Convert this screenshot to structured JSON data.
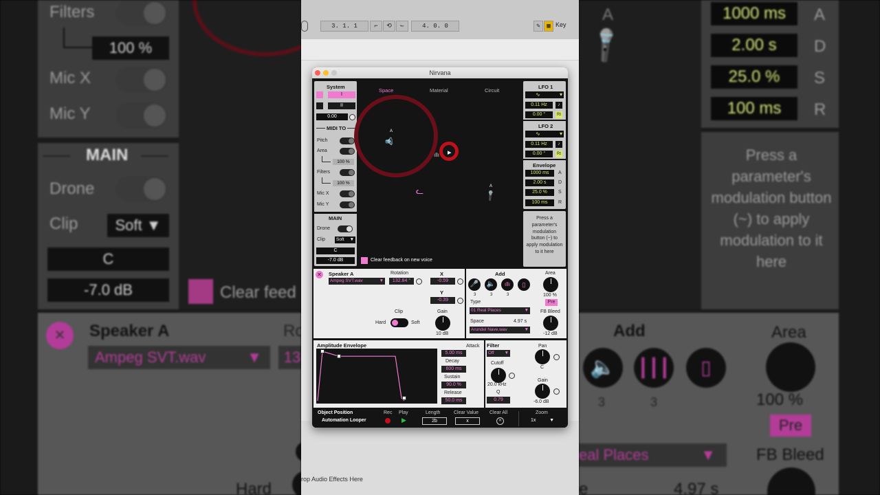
{
  "background_left": {
    "filters_label": "Filters",
    "filters_value": "100 %",
    "micx_label": "Mic X",
    "micy_label": "Mic Y",
    "main_header": "MAIN",
    "drone_label": "Drone",
    "clip_label": "Clip",
    "clip_value": "Soft",
    "note_value": "C",
    "level_value": "-7.0 dB",
    "clear_feedback_partial": "Clear feed",
    "speaker_label": "Speaker A",
    "speaker_file": "Ampeg SVT.wav",
    "rotation_partial": "Ro",
    "rotation_value_partial": "13",
    "hard_label": "Hard"
  },
  "background_right": {
    "attack": "1000 ms",
    "decay": "2.00 s",
    "sustain": "25.0 %",
    "release": "100 ms",
    "a": "A",
    "d": "D",
    "s": "S",
    "r": "R",
    "help_text": "Press a parameter's modulation button (~) to apply modulation to it here",
    "add_label": "Add",
    "area_label": "Area",
    "area_value": "100 %",
    "pre_label": "Pre",
    "count1": "3",
    "count2": "3",
    "type_partial": "eal Places",
    "fb_bleed_label": "FB Bleed",
    "space_time_partial": "4.97 s",
    "space_partial": "e",
    "a_top": "A"
  },
  "transport": {
    "position": "3.  1.  1",
    "loop_length": "4.  0.  0",
    "key_label": "Key"
  },
  "ableton": {
    "drop_hint": "rop Audio Effects Here"
  },
  "window": {
    "title": "Nirvana",
    "system": {
      "header": "System",
      "btn1": "I",
      "btn2": "II",
      "value": "0.00"
    },
    "midi_to": {
      "header": "MIDI TO",
      "pitch": "Pitch",
      "area": "Area",
      "area_value": "100 %",
      "filters": "Filters",
      "filters_value": "100 %",
      "micx": "Mic X",
      "micy": "Mic Y"
    },
    "main": {
      "header": "MAIN",
      "drone": "Drone",
      "clip": "Clip",
      "clip_value": "Soft",
      "note": "C",
      "level": "-7.0 dB"
    },
    "tabs": [
      "Space",
      "Material",
      "Circuit"
    ],
    "field": {
      "speaker_tag": "A",
      "mic_tag": "A",
      "clear_feedback": "Clear feedback on new voice"
    },
    "lfo1": {
      "header": "LFO 1",
      "rate": "0.11 Hz",
      "phase": "0.00 °",
      "rt": "Rt"
    },
    "lfo2": {
      "header": "LFO 2",
      "rate": "0.11 Hz",
      "phase": "0.00 °",
      "rt": "Rt"
    },
    "envelope": {
      "header": "Envelope",
      "a": "1000 ms",
      "d": "2.00 s",
      "s": "25.0 %",
      "r": "100 ms",
      "la": "A",
      "ld": "D",
      "ls": "S",
      "lr": "R"
    },
    "help": "Press a parameter's modulation button (~) to apply modulation to it here",
    "speaker": {
      "name": "Speaker A",
      "file": "Ampeg SVT.wav",
      "rotation_label": "Rotation",
      "rotation": "132.84 °",
      "x_label": "X",
      "x": "-0.59",
      "y_label": "Y",
      "y": "-0.39",
      "clip_label": "Clip",
      "hard": "Hard",
      "soft": "Soft",
      "gain_label": "Gain",
      "gain": "10 dB"
    },
    "mic": {
      "add_label": "Add",
      "counts": [
        "3",
        "3"
      ],
      "type_label": "Type",
      "type_value": "01 Real Places",
      "space_label": "Space",
      "space_time": "4.97 s",
      "space_value": "Arundel Nave.wav",
      "area_label": "Area",
      "area_value": "100 %",
      "pre": "Pre",
      "fb_label": "FB Bleed",
      "fb_value": "-12 dB"
    },
    "amp_env": {
      "header": "Amplitude Envelope",
      "attack_label": "Attack",
      "attack": "5.00 ms",
      "decay_label": "Decay",
      "decay": "600 ms",
      "sustain_label": "Sustain",
      "sustain": "90.0 %",
      "release_label": "Release",
      "release": "50.0 ms",
      "sustain_level": 0.9
    },
    "filter": {
      "header": "Filter",
      "mode": "Off",
      "cutoff_label": "Cutoff",
      "cutoff": "20.0 kHz",
      "q_label": "Q",
      "q": "0.79",
      "pan_label": "Pan",
      "pan": "C",
      "gain_label": "Gain",
      "gain": "-6.0 dB"
    },
    "bottom": {
      "object_position": "Object  Position",
      "automation_looper": "Automation  Looper",
      "rec": "Rec",
      "play": "Play",
      "length_label": "Length",
      "length": "2b",
      "clear_value_label": "Clear Value",
      "clear_value": "x",
      "clear_all": "Clear All",
      "zoom_label": "Zoom",
      "zoom": "1x"
    }
  },
  "colors": {
    "accent_pink": "#f07ad0",
    "accent_green": "#d9e86a",
    "record_red": "#c0101c"
  }
}
